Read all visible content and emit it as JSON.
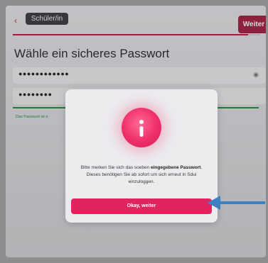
{
  "header": {
    "role_label": "Schüler/in",
    "next_label": "Weiter",
    "progress": 0.95
  },
  "page": {
    "title": "Wähle ein sicheres Passwort",
    "password_value": "●●●●●●●●●●●●",
    "confirm_value": "●●●●●●●●",
    "hint": "Das Passwort ist s"
  },
  "modal": {
    "text_before": "Bitte merken Sie sich das soeben ",
    "text_bold_1": "eingegebene Passwort",
    "text_after": ". Dieses benötigen Sie ab sofort um sich erneut in Sdui einzuloggen.",
    "ok_label": "Okay, weiter"
  },
  "colors": {
    "brand": "#a42041",
    "modal_button": "#e0245e",
    "strength": "#1f8f3a",
    "annotation_arrow": "#3b82c4"
  },
  "icons": {
    "back": "chevron-left-icon",
    "eye": "eye-icon",
    "info": "info-icon",
    "arrow": "arrow-left-annotation-icon"
  }
}
